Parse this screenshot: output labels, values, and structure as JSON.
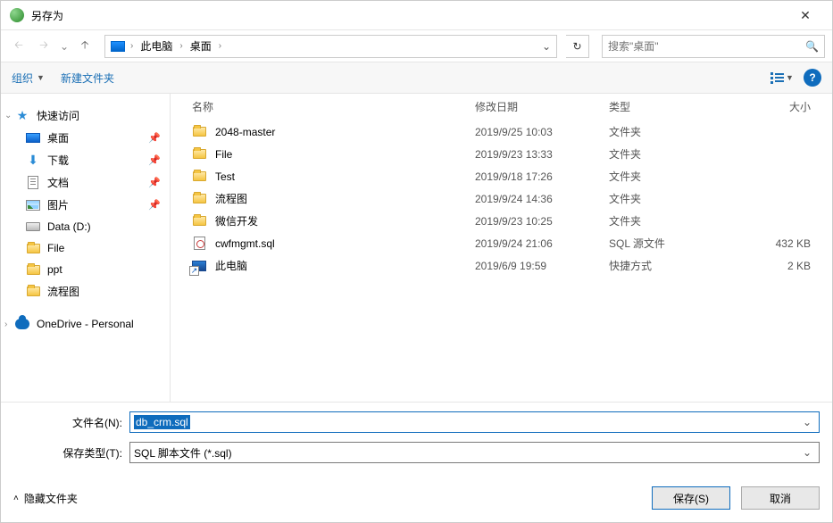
{
  "title": "另存为",
  "breadcrumbs": {
    "root": "此电脑",
    "loc": "桌面"
  },
  "search_placeholder": "搜索\"桌面\"",
  "toolbar": {
    "organize": "组织",
    "newfolder": "新建文件夹"
  },
  "sidebar": {
    "quick": "快速访问",
    "desktop": "桌面",
    "downloads": "下载",
    "documents": "文档",
    "pictures": "图片",
    "data": "Data (D:)",
    "file": "File",
    "ppt": "ppt",
    "flow": "流程图",
    "onedrive": "OneDrive - Personal"
  },
  "columns": {
    "name": "名称",
    "date": "修改日期",
    "type": "类型",
    "size": "大小"
  },
  "rows": [
    {
      "icon": "folder",
      "name": "2048-master",
      "date": "2019/9/25 10:03",
      "type": "文件夹",
      "size": ""
    },
    {
      "icon": "folder",
      "name": "File",
      "date": "2019/9/23 13:33",
      "type": "文件夹",
      "size": ""
    },
    {
      "icon": "folder",
      "name": "Test",
      "date": "2019/9/18 17:26",
      "type": "文件夹",
      "size": ""
    },
    {
      "icon": "folder",
      "name": "流程图",
      "date": "2019/9/24 14:36",
      "type": "文件夹",
      "size": ""
    },
    {
      "icon": "folder",
      "name": "微信开发",
      "date": "2019/9/23 10:25",
      "type": "文件夹",
      "size": ""
    },
    {
      "icon": "sql",
      "name": "cwfmgmt.sql",
      "date": "2019/9/24 21:06",
      "type": "SQL 源文件",
      "size": "432 KB"
    },
    {
      "icon": "pc",
      "name": "此电脑",
      "date": "2019/6/9 19:59",
      "type": "快捷方式",
      "size": "2 KB"
    }
  ],
  "form": {
    "filename_label": "文件名(N):",
    "filename_value": "db_crm.sql",
    "filetype_label": "保存类型(T):",
    "filetype_value": "SQL 脚本文件 (*.sql)"
  },
  "footer": {
    "hide": "隐藏文件夹",
    "save": "保存(S)",
    "cancel": "取消"
  }
}
